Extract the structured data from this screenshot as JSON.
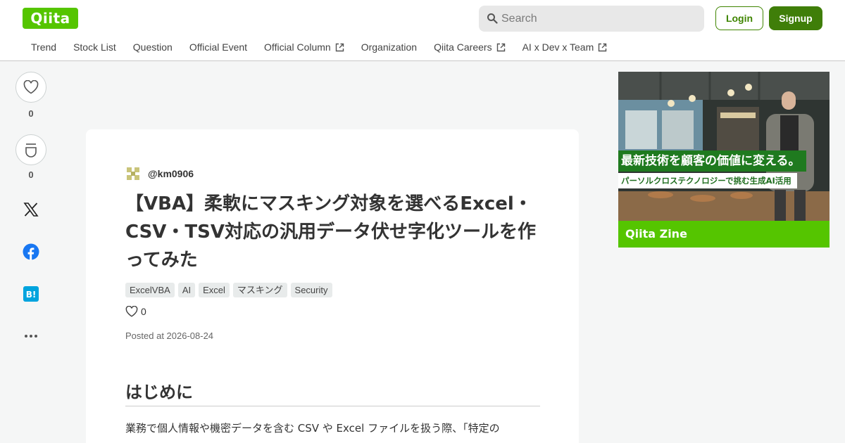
{
  "header": {
    "logo": "Qiita",
    "search_placeholder": "Search",
    "login_label": "Login",
    "signup_label": "Signup"
  },
  "nav": {
    "items": [
      {
        "label": "Trend",
        "external": false
      },
      {
        "label": "Stock List",
        "external": false
      },
      {
        "label": "Question",
        "external": false
      },
      {
        "label": "Official Event",
        "external": false
      },
      {
        "label": "Official Column",
        "external": true
      },
      {
        "label": "Organization",
        "external": false
      },
      {
        "label": "Qiita Careers",
        "external": true
      },
      {
        "label": "AI x Dev x Team",
        "external": true
      }
    ]
  },
  "rail": {
    "like_count": "0",
    "stock_count": "0",
    "icons": [
      "heart-icon",
      "stock-icon",
      "x-icon",
      "facebook-icon",
      "hatena-bookmark-icon",
      "more-icon"
    ]
  },
  "article": {
    "author": "@km0906",
    "title": "【VBA】柔軟にマスキング対象を選べるExcel・CSV・TSV対応の汎用データ伏せ字化ツールを作ってみた",
    "tags": [
      "ExcelVBA",
      "AI",
      "Excel",
      "マスキング",
      "Security"
    ],
    "likes": "0",
    "posted": "Posted at 2026-08-24",
    "section_heading": "はじめに",
    "body_start": "業務で個人情報や機密データを含む CSV や Excel ファイルを扱う際、「特定の"
  },
  "ad": {
    "headline": "最新技術を顧客の価値に変える。",
    "subline": "パーソルクロステクノロジーで挑む生成AI活用",
    "footer": "Qiita Zine"
  },
  "colors": {
    "brand_green": "#55c500",
    "button_green": "#3f7e09",
    "background": "#f5f6f6"
  }
}
